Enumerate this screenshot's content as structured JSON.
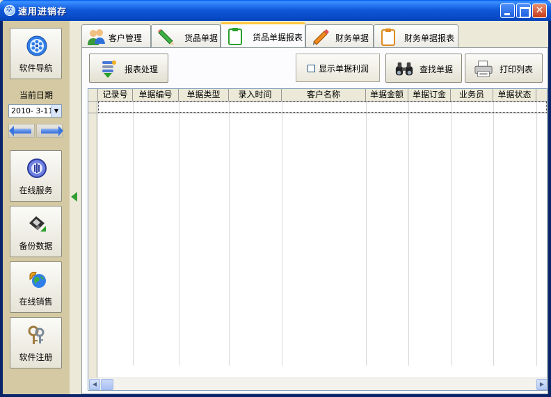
{
  "window": {
    "title": "速用进销存"
  },
  "sidebar": {
    "nav_label": "软件导航",
    "date_label": "当前日期",
    "date_value": "2010- 3-11",
    "buttons": [
      {
        "label": "在线服务"
      },
      {
        "label": "备份数据"
      },
      {
        "label": "在线销售"
      },
      {
        "label": "软件注册"
      }
    ]
  },
  "tabs": [
    {
      "label": "客户管理"
    },
    {
      "label": "货品单据"
    },
    {
      "label": "货品单据报表"
    },
    {
      "label": "财务单据"
    },
    {
      "label": "财务单据报表"
    }
  ],
  "active_tab": "货品单据报表",
  "toolbar": {
    "report_process": "报表处理",
    "show_profit": "显示单据利润",
    "show_profit_checked": false,
    "find": "查找单据",
    "print": "打印列表"
  },
  "grid": {
    "columns": [
      "记录号",
      "单据编号",
      "单据类型",
      "录入时间",
      "客户名称",
      "单据金额",
      "单据订金",
      "业务员",
      "单据状态"
    ],
    "rows": []
  }
}
